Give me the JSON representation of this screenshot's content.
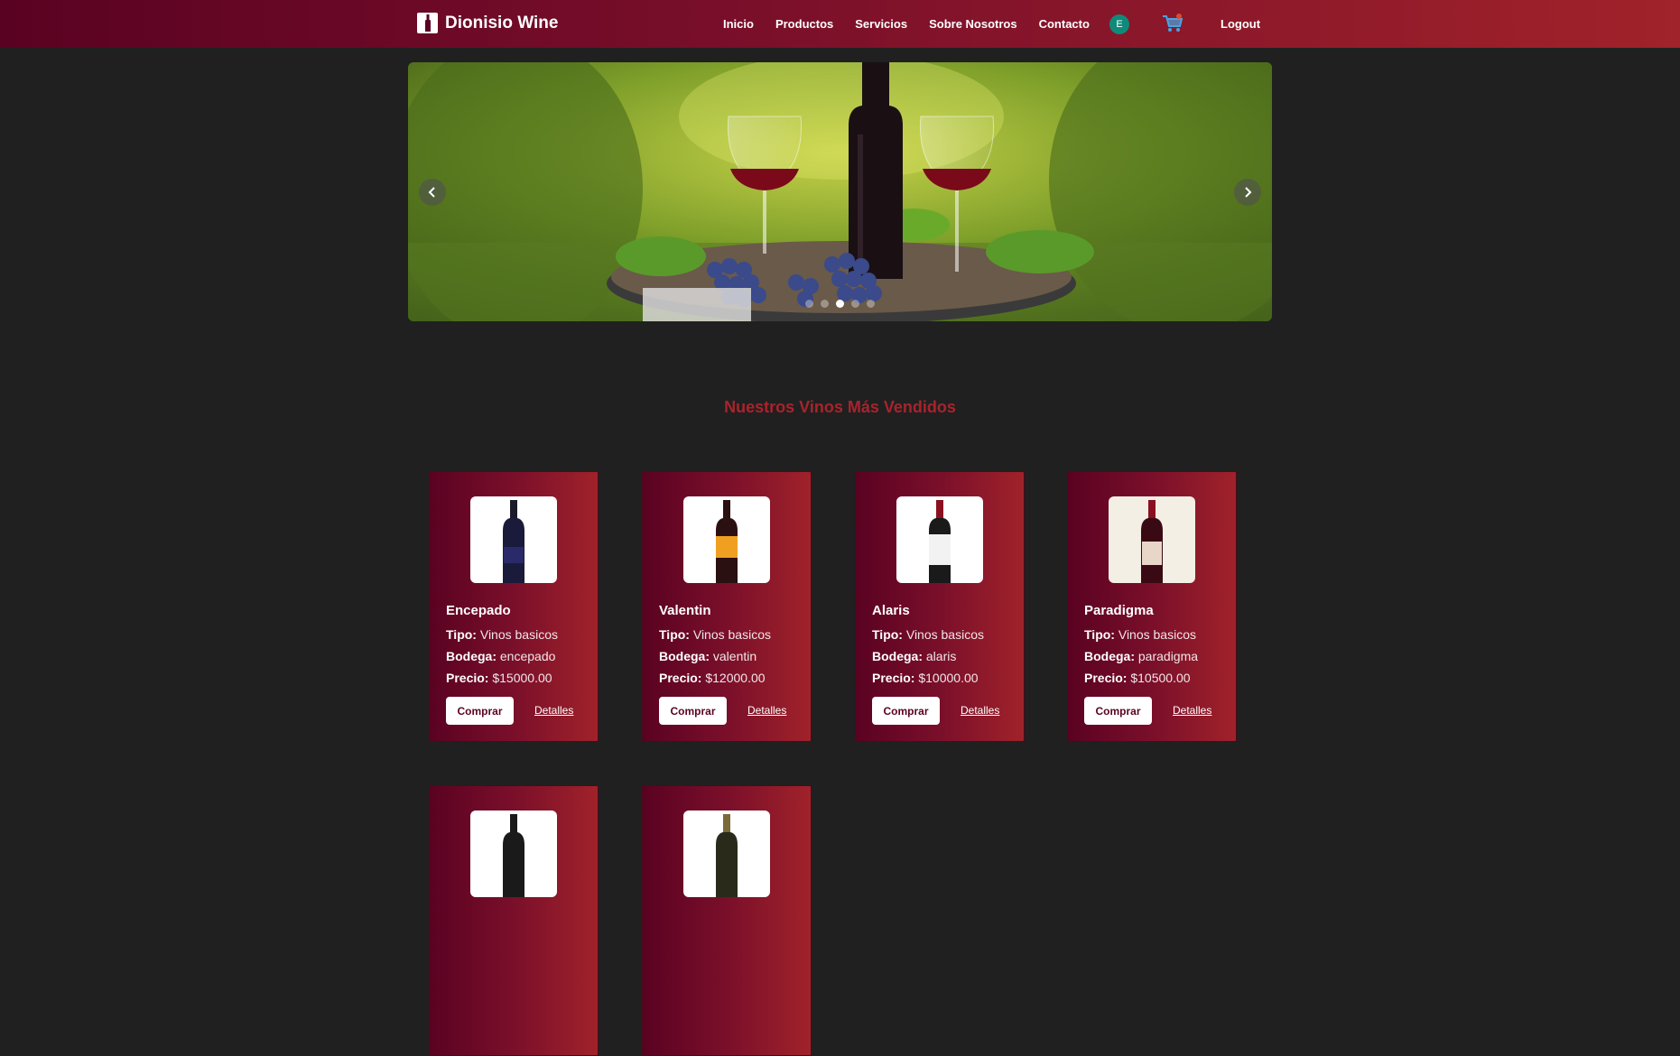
{
  "brand": {
    "name": "Dionisio Wine",
    "logo_icon": "bottle-icon"
  },
  "nav": [
    "Inicio",
    "Productos",
    "Servicios",
    "Sobre Nosotros",
    "Contacto"
  ],
  "user": {
    "initial": "E",
    "color": "#0f8a7a"
  },
  "logout": "Logout",
  "carousel": {
    "slide_count": 5,
    "active_index": 2
  },
  "section_title": "Nuestros Vinos Más Vendidos",
  "labels": {
    "tipo": "Tipo:",
    "bodega": "Bodega:",
    "precio": "Precio:",
    "buy": "Comprar",
    "details": "Detalles"
  },
  "products": [
    {
      "name": "Encepado",
      "tipo": "Vinos basicos",
      "bodega": "encepado",
      "precio": "$15000.00",
      "label_color": "#2a2a6a"
    },
    {
      "name": "Valentin",
      "tipo": "Vinos basicos",
      "bodega": "valentin",
      "precio": "$12000.00",
      "label_color": "#f0a020"
    },
    {
      "name": "Alaris",
      "tipo": "Vinos basicos",
      "bodega": "alaris",
      "precio": "$10000.00",
      "label_color": "#f2f2f2"
    },
    {
      "name": "Paradigma",
      "tipo": "Vinos basicos",
      "bodega": "paradigma",
      "precio": "$10500.00",
      "label_color": "#e8d6c8"
    }
  ],
  "colors": {
    "accent": "#a9232c",
    "topbar": "#7a0f2a",
    "background": "#202020"
  }
}
